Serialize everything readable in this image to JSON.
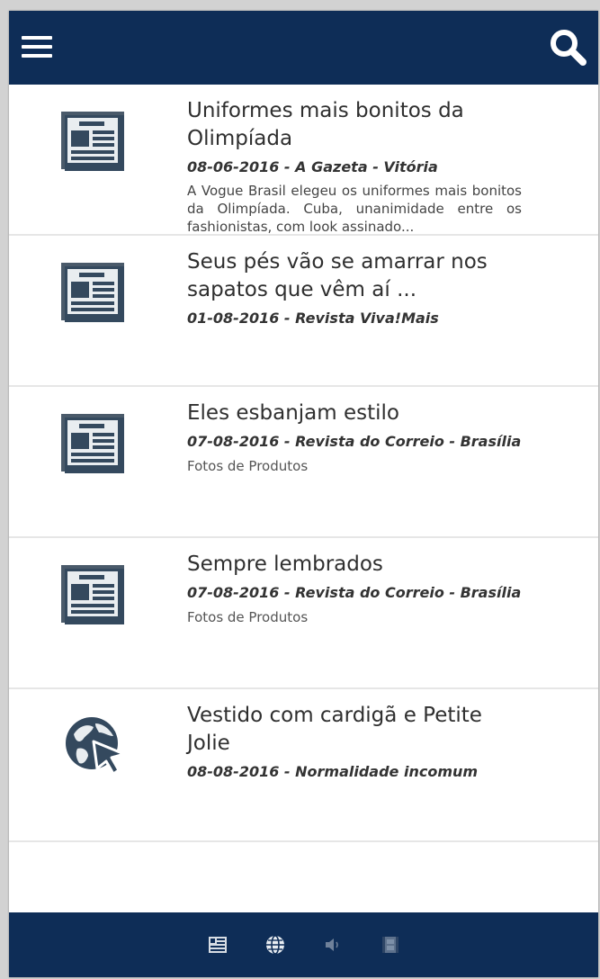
{
  "header": {
    "menu_icon": "hamburger-menu-icon",
    "search_icon": "search-icon",
    "bg_color": "#0e2d57"
  },
  "news": [
    {
      "icon": "newspaper-icon",
      "title": "Uniformes mais bonitos da Olimpíada",
      "meta": "08-06-2016 - A Gazeta - Vitória",
      "description": "A Vogue Brasil elegeu os uniformes mais bonitos da Olimpíada. Cuba, unanimidade entre os fashionistas, com look assinado..."
    },
    {
      "icon": "newspaper-icon",
      "title": "Seus pés vão se amarrar nos sapatos que vêm aí ...",
      "meta": "01-08-2016 - Revista Viva!Mais"
    },
    {
      "icon": "newspaper-icon",
      "title": "Eles esbanjam estilo",
      "meta": "07-08-2016 - Revista do Correio - Brasília",
      "subtitle": "Fotos de Produtos"
    },
    {
      "icon": "newspaper-icon",
      "title": "Sempre lembrados",
      "meta": "07-08-2016 - Revista do Correio - Brasília",
      "subtitle": "Fotos de Produtos"
    },
    {
      "icon": "web-globe-cursor-icon",
      "title": "Vestido com cardigã e Petite Jolie",
      "meta": "08-08-2016 - Normalidade incomum"
    }
  ],
  "bottom_tabs": [
    {
      "icon": "newspaper-tab-icon"
    },
    {
      "icon": "globe-tab-icon"
    },
    {
      "icon": "speaker-tab-icon"
    },
    {
      "icon": "film-tab-icon"
    }
  ]
}
